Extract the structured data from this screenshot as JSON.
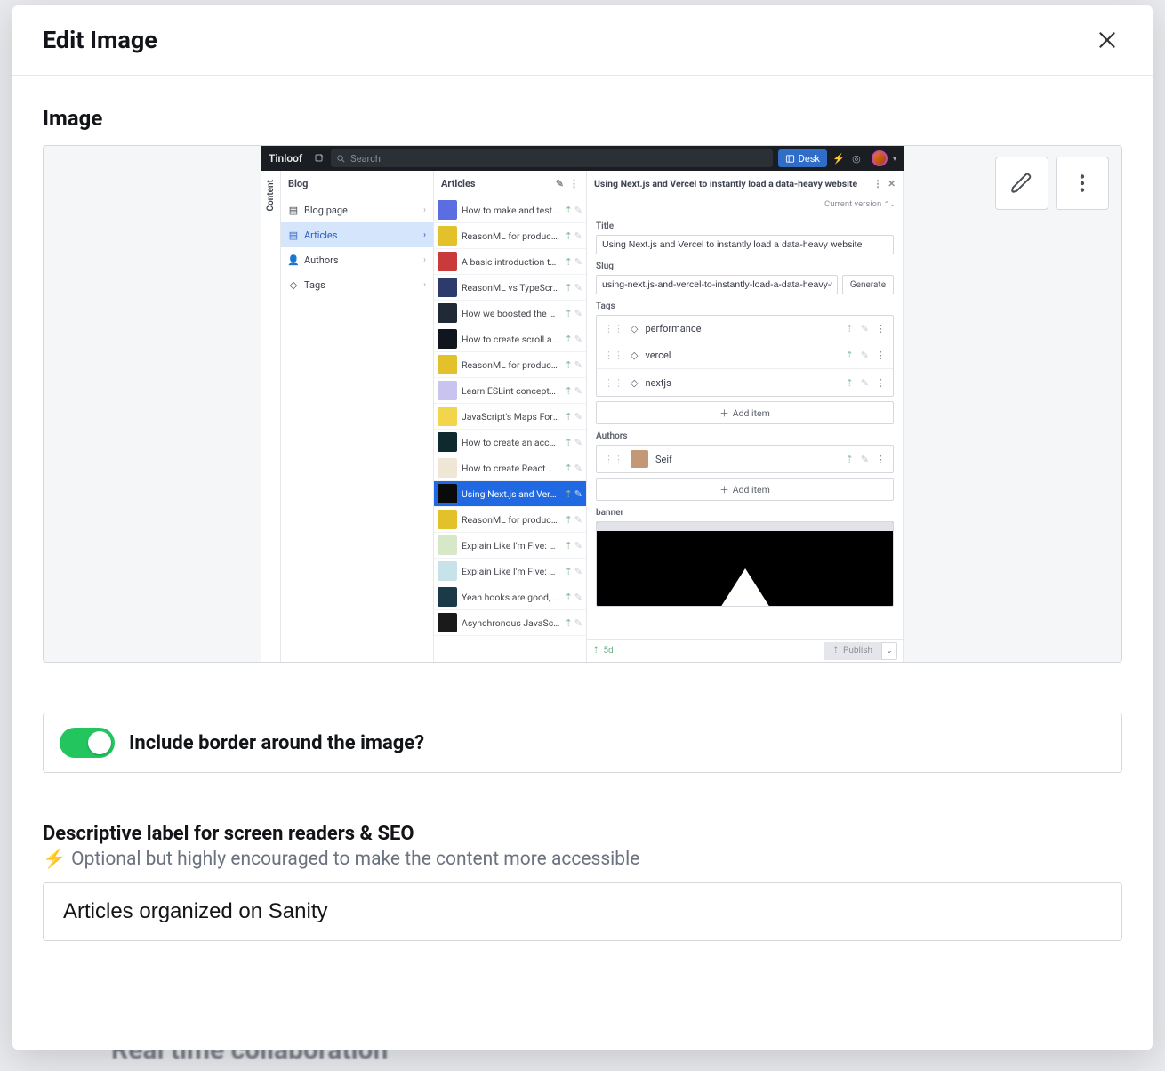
{
  "modal": {
    "title": "Edit Image",
    "image_section_label": "Image",
    "toggle_label": "Include border around the image?",
    "toggle_on": true,
    "alt_heading": "Descriptive label for screen readers & SEO",
    "alt_sub": "Optional but highly encouraged to make the content more accessible",
    "alt_value": "Articles organized on Sanity"
  },
  "background_hint": "Real time collaboration",
  "preview": {
    "brand": "Tinloof",
    "search_placeholder": "Search",
    "desk_label": "Desk",
    "vtab": "Content",
    "col_blog_title": "Blog",
    "col_articles_title": "Articles",
    "blog_nav": [
      {
        "label": "Blog page",
        "active": false,
        "icon": "doc"
      },
      {
        "label": "Articles",
        "active": true,
        "icon": "doc"
      },
      {
        "label": "Authors",
        "active": false,
        "icon": "user"
      },
      {
        "label": "Tags",
        "active": false,
        "icon": "tag"
      }
    ],
    "articles": [
      {
        "t": "How to make and test yo…",
        "c": "#5b6ee1"
      },
      {
        "t": "ReasonML for productio…",
        "c": "#e2c12a"
      },
      {
        "t": "A basic introduction to f…",
        "c": "#c93a3a"
      },
      {
        "t": "ReasonML vs TypeScript…",
        "c": "#2e3a6b"
      },
      {
        "t": "How we boosted the per…",
        "c": "#1f2a36"
      },
      {
        "t": "How to create scroll ani…",
        "c": "#10161d"
      },
      {
        "t": "ReasonML for productio…",
        "c": "#e2c12a"
      },
      {
        "t": "Learn ESLint concepts, n…",
        "c": "#c9c4ef"
      },
      {
        "t": "JavaScript's Maps For B…",
        "c": "#f2d54a"
      },
      {
        "t": "How to create an access…",
        "c": "#0f2a2e"
      },
      {
        "t": "How to create React Not…",
        "c": "#efe6d6"
      },
      {
        "t": "Using Next.js and Vercel …",
        "c": "#0a0a0a",
        "selected": true
      },
      {
        "t": "ReasonML for productio…",
        "c": "#e2c12a"
      },
      {
        "t": "Explain Like I'm Five: We…",
        "c": "#d7e8c8"
      },
      {
        "t": "Explain Like I'm Five: Rea…",
        "c": "#c8e2ea"
      },
      {
        "t": "Yeah hooks are good, bu…",
        "c": "#1a3a4a"
      },
      {
        "t": "Asynchronous JavaScrip…",
        "c": "#1a1a1a"
      }
    ],
    "detail": {
      "doc_title": "Using Next.js and Vercel to instantly load a data-heavy website",
      "version": "Current version",
      "labels": {
        "title": "Title",
        "slug": "Slug",
        "tags": "Tags",
        "authors": "Authors",
        "banner": "banner"
      },
      "title_value": "Using Next.js and Vercel to instantly load a data-heavy website",
      "slug_value": "using-next.js-and-vercel-to-instantly-load-a-data-heavy-web",
      "generate": "Generate",
      "tags": [
        "performance",
        "vercel",
        "nextjs"
      ],
      "add_item": "Add item",
      "author": "Seif",
      "footer_age": "5d",
      "publish": "Publish"
    }
  }
}
